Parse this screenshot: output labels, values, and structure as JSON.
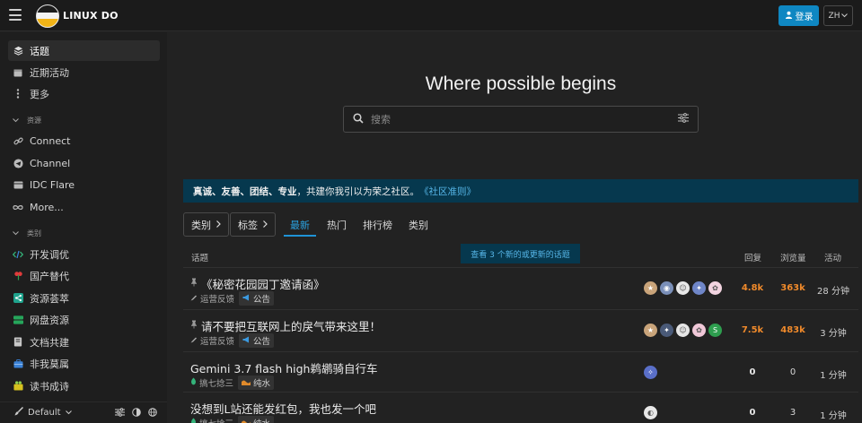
{
  "header": {
    "site_name": "LINUX DO",
    "login_label": "登录",
    "lang_label": "ZH"
  },
  "sidebar": {
    "top_items": [
      {
        "label": "话题",
        "icon": "layers-icon",
        "active": true
      },
      {
        "label": "近期活动",
        "icon": "calendar-icon"
      },
      {
        "label": "更多",
        "icon": "more-vertical-icon"
      }
    ],
    "resources_header": "资源",
    "resources": [
      {
        "label": "Connect",
        "icon": "link-icon"
      },
      {
        "label": "Channel",
        "icon": "telegram-icon"
      },
      {
        "label": "IDC Flare",
        "icon": "card-icon"
      },
      {
        "label": "More...",
        "icon": "infinity-icon"
      }
    ],
    "categories_header": "类别",
    "categories": [
      {
        "label": "开发调优",
        "icon": "code-icon",
        "color": "#34b37a"
      },
      {
        "label": "国产替代",
        "icon": "flower-icon",
        "color": "#e03b3b"
      },
      {
        "label": "资源荟萃",
        "icon": "share-icon",
        "color": "#1fa38d"
      },
      {
        "label": "网盘资源",
        "icon": "storage-icon",
        "color": "#26a65b"
      },
      {
        "label": "文档共建",
        "icon": "book-icon",
        "color": "#c8c8c8"
      },
      {
        "label": "非我莫属",
        "icon": "briefcase-icon",
        "color": "#3b82d6"
      },
      {
        "label": "读书成诗",
        "icon": "book-open-icon",
        "color": "#d6c21f"
      }
    ],
    "footer_theme": "Default"
  },
  "main": {
    "hero_title": "Where possible begins",
    "search_placeholder": "搜索",
    "banner_bold": "真诚、友善、团结、专业",
    "banner_text": "，共建你我引以为荣之社区。",
    "banner_link": "《社区准则》",
    "filters": {
      "category_label": "类别",
      "tag_label": "标签"
    },
    "tabs": [
      {
        "label": "最新",
        "active": true
      },
      {
        "label": "热门"
      },
      {
        "label": "排行榜"
      },
      {
        "label": "类别"
      }
    ],
    "columns": {
      "topic": "话题",
      "replies": "回复",
      "views": "浏览量",
      "activity": "活动"
    },
    "new_topics_notice": "查看 3 个新的或更新的话题",
    "topics": [
      {
        "title": "《秘密花园园丁邀请函》",
        "pinned": true,
        "category": "运营反馈",
        "tag": "公告",
        "tag_icon": "megaphone-icon",
        "replies": "4.8k",
        "views": "363k",
        "activity": "28 分钟",
        "hot": true,
        "posters": [
          {
            "color": "#c9a47a",
            "glyph": "★"
          },
          {
            "color": "#7a8fb8",
            "glyph": "◉"
          },
          {
            "color": "#e8e8e8",
            "glyph": "☺"
          },
          {
            "color": "#6f86c8",
            "glyph": "✦"
          },
          {
            "color": "#f2d4e0",
            "glyph": "✿"
          }
        ]
      },
      {
        "title": "请不要把互联网上的戾气带来这里！",
        "pinned": true,
        "category": "运营反馈",
        "tag": "公告",
        "tag_icon": "megaphone-icon",
        "replies": "7.5k",
        "views": "483k",
        "activity": "3 分钟",
        "hot": true,
        "posters": [
          {
            "color": "#c9a47a",
            "glyph": "★"
          },
          {
            "color": "#4a5a78",
            "glyph": "✦"
          },
          {
            "color": "#e6e6e6",
            "glyph": "☺"
          },
          {
            "color": "#f0c8d8",
            "glyph": "✿"
          },
          {
            "color": "#2e9e4f",
            "glyph": "S"
          }
        ]
      },
      {
        "title": "Gemini 3.7 flash high鹈鹕骑自行车",
        "pinned": false,
        "category": "搞七捻三",
        "tag": "纯水",
        "tag_icon": "water-icon",
        "replies": "0",
        "views": "0",
        "activity": "1 分钟",
        "hot": false,
        "posters": [
          {
            "color": "#5a6fc8",
            "glyph": "✧"
          }
        ]
      },
      {
        "title": "没想到L站还能发红包，我也发一个吧",
        "pinned": false,
        "category": "搞七捻三",
        "tag": "纯水",
        "tag_icon": "water-icon",
        "replies": "0",
        "views": "3",
        "activity": "1 分钟",
        "hot": false,
        "posters": [
          {
            "color": "#e8e8e8",
            "glyph": "◐"
          }
        ]
      }
    ]
  }
}
